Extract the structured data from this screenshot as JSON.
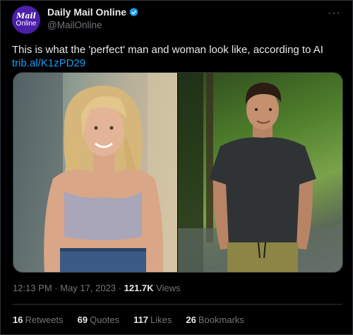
{
  "author": {
    "avatar_line1": "Mail",
    "avatar_line2": "Online",
    "display_name": "Daily Mail Online",
    "handle": "@MailOnline"
  },
  "more_label": "···",
  "tweet": {
    "text": "This is what the 'perfect' man and woman look like, according to AI",
    "link": "trib.al/K1zPD29"
  },
  "media": {
    "left_image": "ai-generated-woman-photo",
    "right_image": "ai-generated-man-photo"
  },
  "meta": {
    "time": "12:13 PM",
    "date": "May 17, 2023",
    "separator": "·",
    "views_count": "121.7K",
    "views_label": "Views"
  },
  "stats": {
    "retweets_count": "16",
    "retweets_label": "Retweets",
    "quotes_count": "69",
    "quotes_label": "Quotes",
    "likes_count": "117",
    "likes_label": "Likes",
    "bookmarks_count": "26",
    "bookmarks_label": "Bookmarks"
  },
  "colors": {
    "background": "#000000",
    "link": "#1d9bf0",
    "verified": "#1d9bf0",
    "avatar_bg": "#4b1fa8",
    "muted": "#71767b"
  }
}
